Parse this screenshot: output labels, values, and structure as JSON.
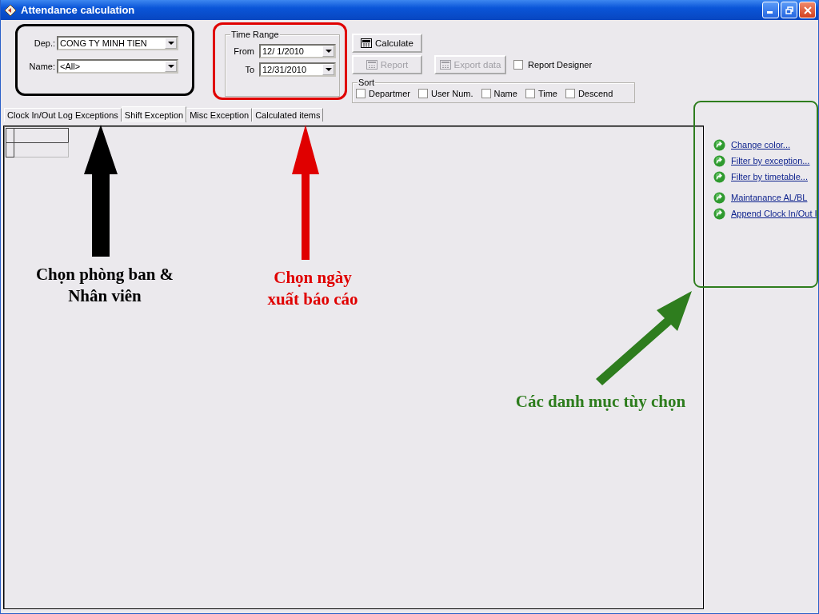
{
  "window": {
    "title": "Attendance calculation"
  },
  "filters": {
    "dep_label": "Dep.:",
    "dep_value": "CONG TY MINH TIEN",
    "name_label": "Name:",
    "name_value": "<All>"
  },
  "time_range": {
    "title": "Time Range",
    "from_label": "From",
    "from_value": "12/ 1/2010",
    "to_label": "To",
    "to_value": "12/31/2010"
  },
  "buttons": [
    {
      "label": "Calculate",
      "disabled": false
    },
    {
      "label": "Report",
      "disabled": true
    },
    {
      "label": "Export data",
      "disabled": true
    }
  ],
  "report_designer": {
    "label": "Report Designer",
    "checked": false
  },
  "sort": {
    "title": "Sort",
    "options": [
      {
        "label": "Departmer",
        "checked": false
      },
      {
        "label": "User Num.",
        "checked": false
      },
      {
        "label": "Name",
        "checked": false
      },
      {
        "label": "Time",
        "checked": false
      },
      {
        "label": "Descend",
        "checked": false
      }
    ]
  },
  "tabs": [
    {
      "label": "Clock In/Out Log Exceptions",
      "selected": false
    },
    {
      "label": "Shift Exception",
      "selected": true
    },
    {
      "label": "Misc Exception",
      "selected": false
    },
    {
      "label": "Calculated items",
      "selected": false
    }
  ],
  "link_groups": [
    [
      {
        "label": "Change color..."
      },
      {
        "label": "Filter by exception..."
      },
      {
        "label": "Filter by timetable..."
      }
    ],
    [
      {
        "label": "Maintanance AL/BL"
      },
      {
        "label": "Append Clock In/Out I"
      }
    ]
  ],
  "annotations": [
    {
      "text": "Chọn phòng ban &\nNhân viên",
      "color": "#000000"
    },
    {
      "text": "Chọn ngày\nxuất báo cáo",
      "color": "#e00000"
    },
    {
      "text": "Các danh mục tùy chọn",
      "color": "#2e7d1e"
    }
  ]
}
